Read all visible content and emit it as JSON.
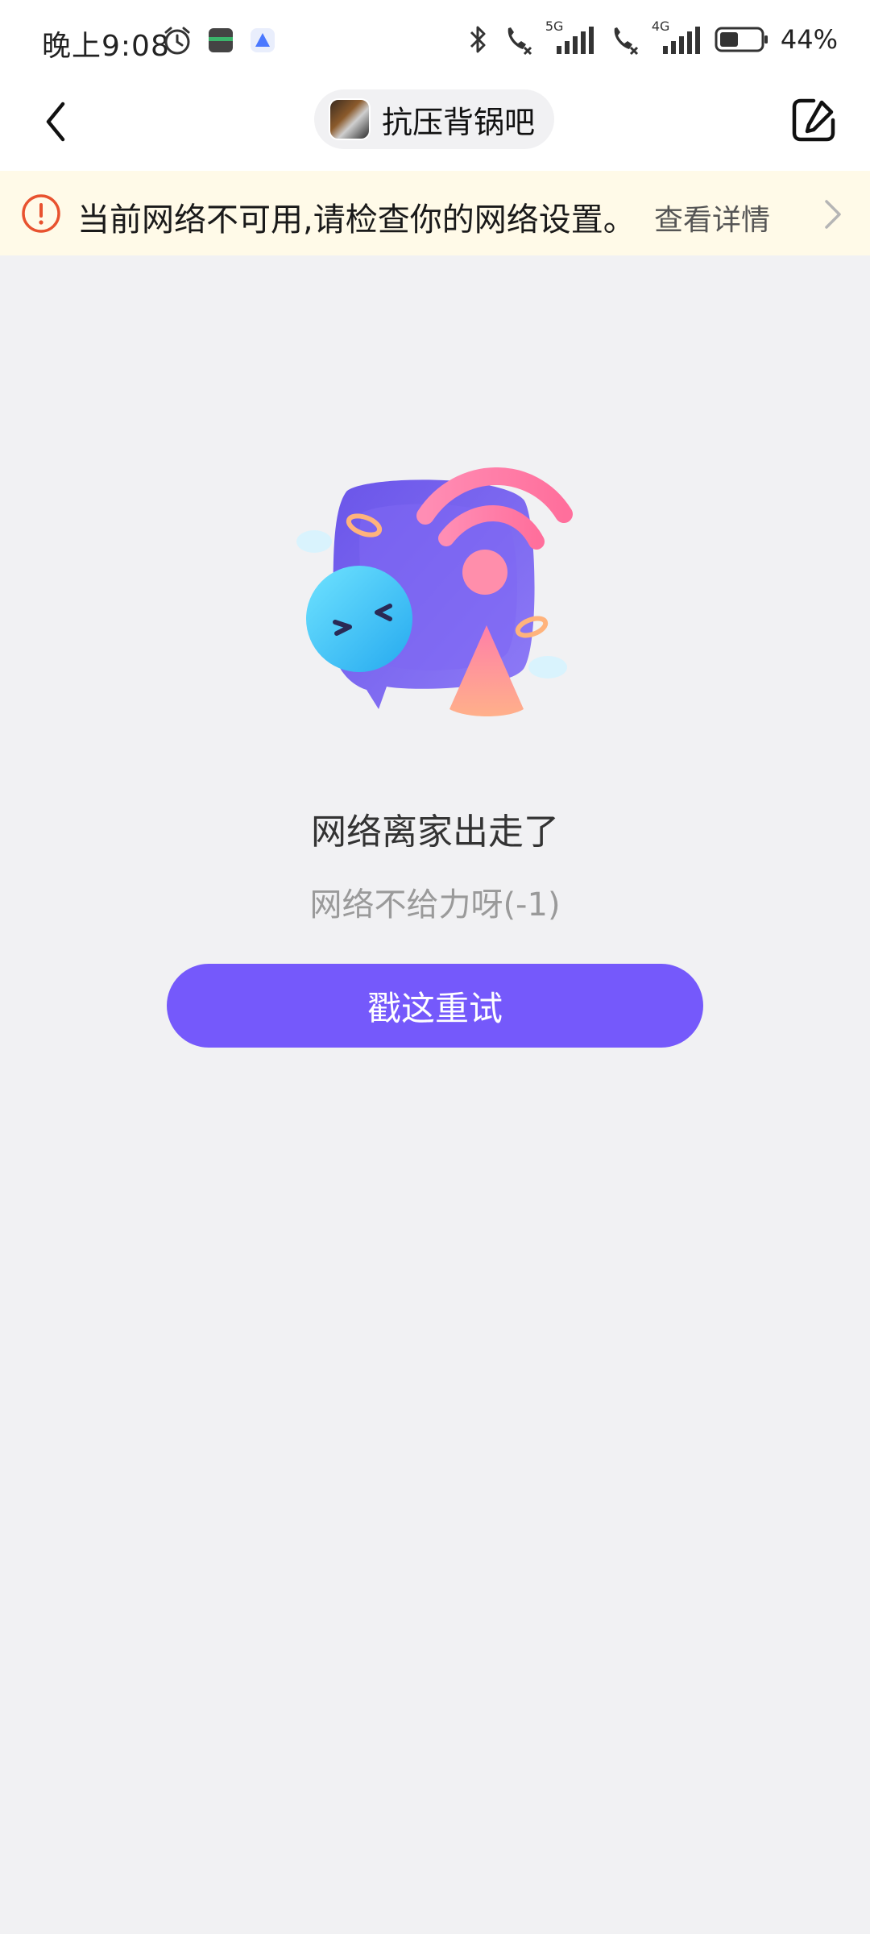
{
  "status_bar": {
    "time": "晚上9:08",
    "battery_percent": "44%",
    "network_5g": "5G",
    "network_4g": "4G",
    "icons": [
      "alarm-icon",
      "app-notification-icon",
      "app-notification-icon-2",
      "bluetooth-icon",
      "call-disabled-icon",
      "signal-5g-icon",
      "call-disabled-icon",
      "signal-4g-icon",
      "battery-icon"
    ]
  },
  "header": {
    "forum_name": "抗压背锅吧",
    "back_icon": "chevron-left-icon",
    "edit_icon": "edit-icon"
  },
  "network_banner": {
    "message": "当前网络不可用,请检查你的网络设置。",
    "detail_link": "查看详情",
    "icon": "warning-icon",
    "color": "#fffae8",
    "icon_color": "#e8522f"
  },
  "empty_state": {
    "title": "网络离家出走了",
    "subtitle": "网络不给力呀(-1)",
    "retry_label": "戳这重试",
    "accent_color": "#7559fb"
  }
}
